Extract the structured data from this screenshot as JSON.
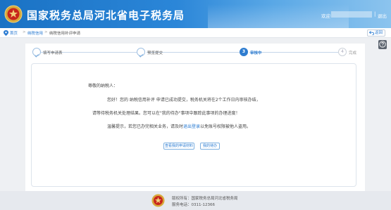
{
  "header": {
    "title": "国家税务总局河北省电子税务局",
    "welcome": "欢迎",
    "separator": "|",
    "logout": "退出"
  },
  "breadcrumb": {
    "items": [
      "首页",
      "纳税信用",
      "纳税信用补评申请"
    ],
    "back_label": "返回"
  },
  "steps": [
    {
      "num": "",
      "label": "填写申请表",
      "state": "done"
    },
    {
      "num": "",
      "label": "预览提交",
      "state": "done"
    },
    {
      "num": "3",
      "label": "审核中",
      "state": "active"
    },
    {
      "num": "4",
      "label": "完成",
      "state": "todo"
    }
  ],
  "message": {
    "greeting": "尊敬的纳税人：",
    "line1": "您好！您的 纳税信用补评 申请已成功提交，税务机关将在2个工作日内审核办结，",
    "line2": "请等待税务机关处理结果。您可以在\"我的待办\"事项中跟踪此事项的办理进度！",
    "line3_prefix": "温馨提示，若您已办完相关业务，请及时",
    "line3_link": "退出登录",
    "line3_suffix": "以免账号权限被他人盗用。",
    "btn_view": "查看我的申请材料",
    "btn_todo": "我的待办"
  },
  "footer": {
    "sponsor": "版权所有：国家税务总局河北省税务局",
    "hotline": "服务电话：0311-12366"
  },
  "colors": {
    "header_blue": "#1a72c4",
    "accent": "#2a7bd2",
    "emblem_red": "#c8261c"
  }
}
